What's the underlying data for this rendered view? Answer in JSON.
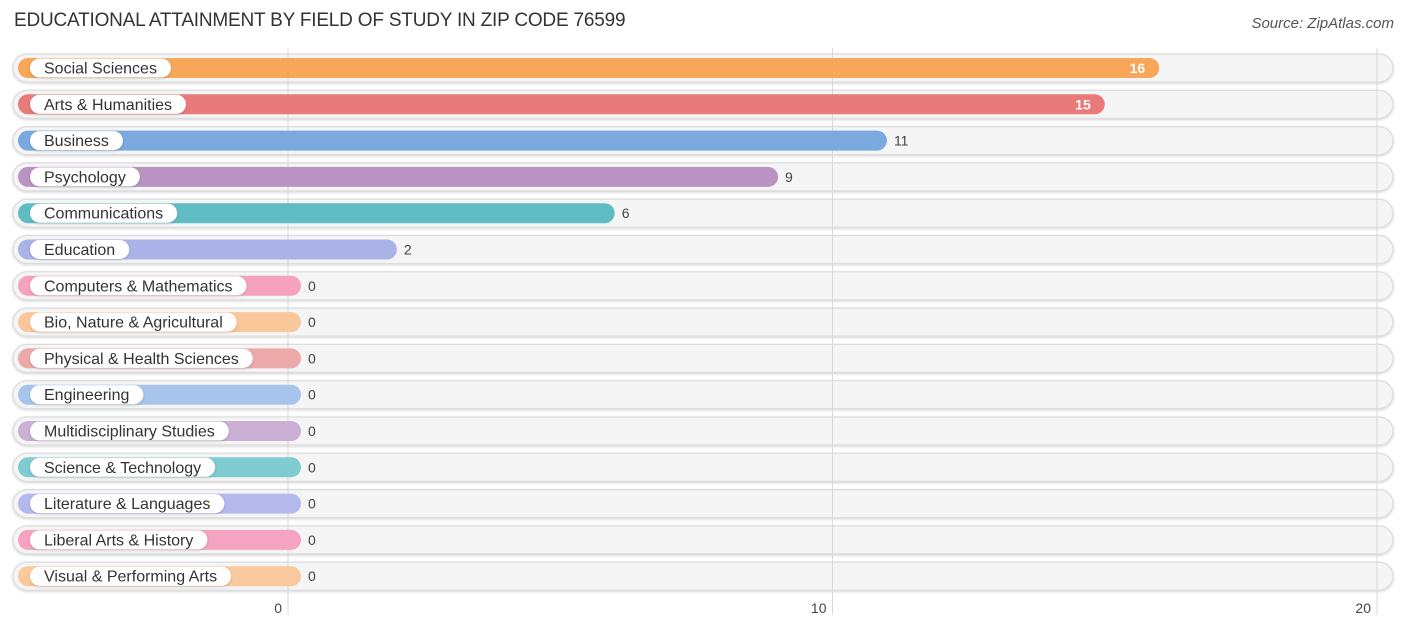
{
  "title": "EDUCATIONAL ATTAINMENT BY FIELD OF STUDY IN ZIP CODE 76599",
  "source": "Source: ZipAtlas.com",
  "chart_data": {
    "type": "bar",
    "orientation": "horizontal",
    "title": "EDUCATIONAL ATTAINMENT BY FIELD OF STUDY IN ZIP CODE 76599",
    "xlabel": "",
    "ylabel": "",
    "xlim": [
      0,
      20
    ],
    "xticks": [
      0,
      10,
      20
    ],
    "grid": true,
    "categories": [
      "Social Sciences",
      "Arts & Humanities",
      "Business",
      "Psychology",
      "Communications",
      "Education",
      "Computers & Mathematics",
      "Bio, Nature & Agricultural",
      "Physical & Health Sciences",
      "Engineering",
      "Multidisciplinary Studies",
      "Science & Technology",
      "Literature & Languages",
      "Liberal Arts & History",
      "Visual & Performing Arts"
    ],
    "values": [
      16,
      15,
      11,
      9,
      6,
      2,
      0,
      0,
      0,
      0,
      0,
      0,
      0,
      0,
      0
    ],
    "colors": [
      "#f7a65a",
      "#e87a7a",
      "#7aa9e0",
      "#bb93c3",
      "#5fbcc5",
      "#aab3e8",
      "#f4a2bd",
      "#f9c79a",
      "#eca9a9",
      "#a6c4ec",
      "#cbafd4",
      "#7ecbd1",
      "#b3b9ec",
      "#f5a3c0",
      "#f9c89d"
    ]
  }
}
